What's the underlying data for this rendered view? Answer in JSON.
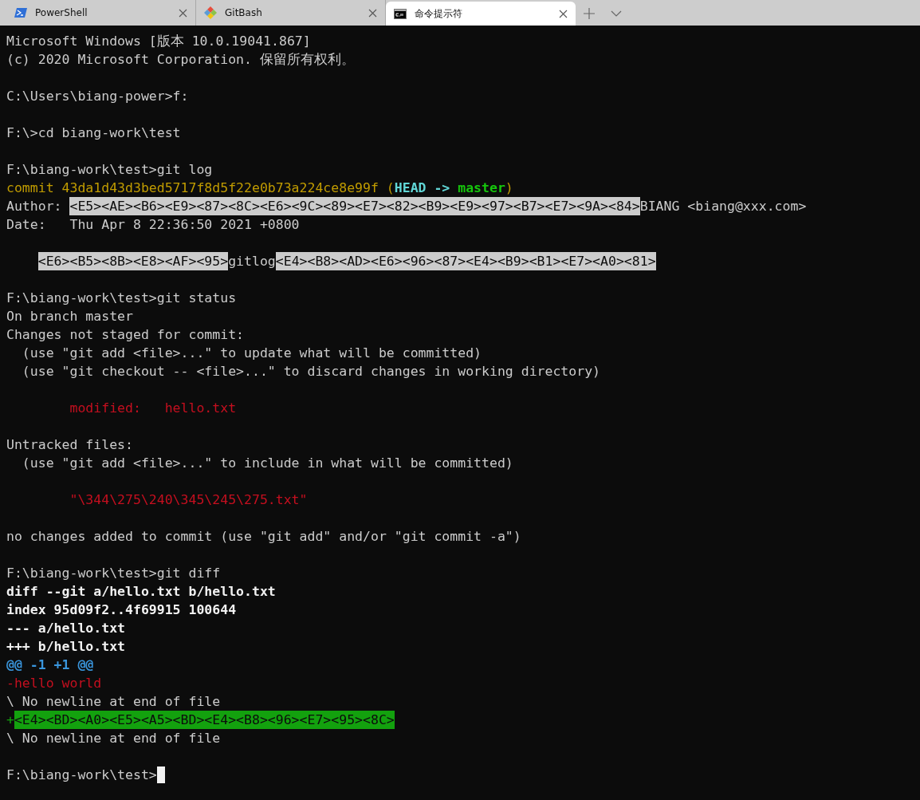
{
  "tabs": [
    {
      "kind": "powershell",
      "label": "PowerShell",
      "selected": false
    },
    {
      "kind": "git",
      "label": "GitBash",
      "selected": false
    },
    {
      "kind": "cmd",
      "label": "命令提示符",
      "selected": true
    }
  ],
  "terminal": {
    "lines": [
      {
        "kind": "text",
        "segments": [
          {
            "kind": "normal",
            "text": "Microsoft Windows [版本 10.0.19041.867]"
          }
        ]
      },
      {
        "kind": "text",
        "segments": [
          {
            "kind": "normal",
            "text": "(c) 2020 Microsoft Corporation. 保留所有权利。"
          }
        ]
      },
      {
        "kind": "blank"
      },
      {
        "kind": "text",
        "segments": [
          {
            "kind": "normal",
            "text": "C:\\Users\\biang-power>f:"
          }
        ]
      },
      {
        "kind": "blank"
      },
      {
        "kind": "text",
        "segments": [
          {
            "kind": "normal",
            "text": "F:\\>cd biang-work\\test"
          }
        ]
      },
      {
        "kind": "blank"
      },
      {
        "kind": "text",
        "segments": [
          {
            "kind": "normal",
            "text": "F:\\biang-work\\test>git log"
          }
        ]
      },
      {
        "kind": "text",
        "segments": [
          {
            "kind": "commit",
            "text": "commit 43da1d43d3bed5717f8d5f22e0b73a224ce8e99f ("
          },
          {
            "kind": "head",
            "text": "HEAD -> "
          },
          {
            "kind": "branch",
            "text": "master"
          },
          {
            "kind": "commit",
            "text": ")"
          }
        ]
      },
      {
        "kind": "text",
        "segments": [
          {
            "kind": "normal",
            "text": "Author: "
          },
          {
            "kind": "bytes",
            "text": "<E5><AE><B6><E9><87><8C><E6><9C><89><E7><82><B9><E9><97><B7><E7><9A><84>"
          },
          {
            "kind": "normal",
            "text": "BIANG <biang@xxx.com>"
          }
        ]
      },
      {
        "kind": "text",
        "segments": [
          {
            "kind": "normal",
            "text": "Date:   Thu Apr 8 22:36:50 2021 +0800"
          }
        ]
      },
      {
        "kind": "blank"
      },
      {
        "kind": "message",
        "segments": [
          {
            "kind": "bytes",
            "text": "<E6><B5><8B><E8><AF><95>"
          },
          {
            "kind": "normal",
            "text": "gitlog"
          },
          {
            "kind": "bytes",
            "text": "<E4><B8><AD><E6><96><87><E4><B9><B1><E7><A0><81>"
          }
        ]
      },
      {
        "kind": "blank"
      },
      {
        "kind": "text",
        "segments": [
          {
            "kind": "normal",
            "text": "F:\\biang-work\\test>git status"
          }
        ]
      },
      {
        "kind": "text",
        "segments": [
          {
            "kind": "normal",
            "text": "On branch master"
          }
        ]
      },
      {
        "kind": "text",
        "segments": [
          {
            "kind": "normal",
            "text": "Changes not staged for commit:"
          }
        ]
      },
      {
        "kind": "text",
        "segments": [
          {
            "kind": "normal",
            "text": "  (use \"git add <file>...\" to update what will be committed)"
          }
        ]
      },
      {
        "kind": "text",
        "segments": [
          {
            "kind": "normal",
            "text": "  (use \"git checkout -- <file>...\" to discard changes in working directory)"
          }
        ]
      },
      {
        "kind": "blank"
      },
      {
        "kind": "file",
        "segments": [
          {
            "kind": "removed",
            "text": "modified:   hello.txt"
          }
        ]
      },
      {
        "kind": "blank"
      },
      {
        "kind": "text",
        "segments": [
          {
            "kind": "normal",
            "text": "Untracked files:"
          }
        ]
      },
      {
        "kind": "text",
        "segments": [
          {
            "kind": "normal",
            "text": "  (use \"git add <file>...\" to include in what will be committed)"
          }
        ]
      },
      {
        "kind": "blank"
      },
      {
        "kind": "file",
        "segments": [
          {
            "kind": "removed",
            "text": "\"\\344\\275\\240\\345\\245\\275.txt\""
          }
        ]
      },
      {
        "kind": "blank"
      },
      {
        "kind": "text",
        "segments": [
          {
            "kind": "normal",
            "text": "no changes added to commit (use \"git add\" and/or \"git commit -a\")"
          }
        ]
      },
      {
        "kind": "blank"
      },
      {
        "kind": "text",
        "segments": [
          {
            "kind": "normal",
            "text": "F:\\biang-work\\test>git diff"
          }
        ]
      },
      {
        "kind": "text",
        "segments": [
          {
            "kind": "meta",
            "text": "diff --git a/hello.txt b/hello.txt"
          }
        ]
      },
      {
        "kind": "text",
        "segments": [
          {
            "kind": "meta",
            "text": "index 95d09f2..4f69915 100644"
          }
        ]
      },
      {
        "kind": "text",
        "segments": [
          {
            "kind": "meta",
            "text": "--- a/hello.txt"
          }
        ]
      },
      {
        "kind": "text",
        "segments": [
          {
            "kind": "meta",
            "text": "+++ b/hello.txt"
          }
        ]
      },
      {
        "kind": "text",
        "segments": [
          {
            "kind": "hunk",
            "text": "@@ -1 +1 @@"
          }
        ]
      },
      {
        "kind": "text",
        "segments": [
          {
            "kind": "removed",
            "text": "-hello world"
          }
        ]
      },
      {
        "kind": "text",
        "segments": [
          {
            "kind": "normal",
            "text": "\\ No newline at end of file"
          }
        ]
      },
      {
        "kind": "text",
        "segments": [
          {
            "kind": "plus",
            "text": "+"
          },
          {
            "kind": "added",
            "text": "<E4><BD><A0><E5><A5><BD><E4><B8><96><E7><95><8C>"
          }
        ]
      },
      {
        "kind": "text",
        "segments": [
          {
            "kind": "normal",
            "text": "\\ No newline at end of file"
          }
        ]
      },
      {
        "kind": "blank"
      },
      {
        "kind": "prompt",
        "cursor": true,
        "segments": [
          {
            "kind": "normal",
            "text": "F:\\biang-work\\test>"
          }
        ]
      }
    ]
  }
}
